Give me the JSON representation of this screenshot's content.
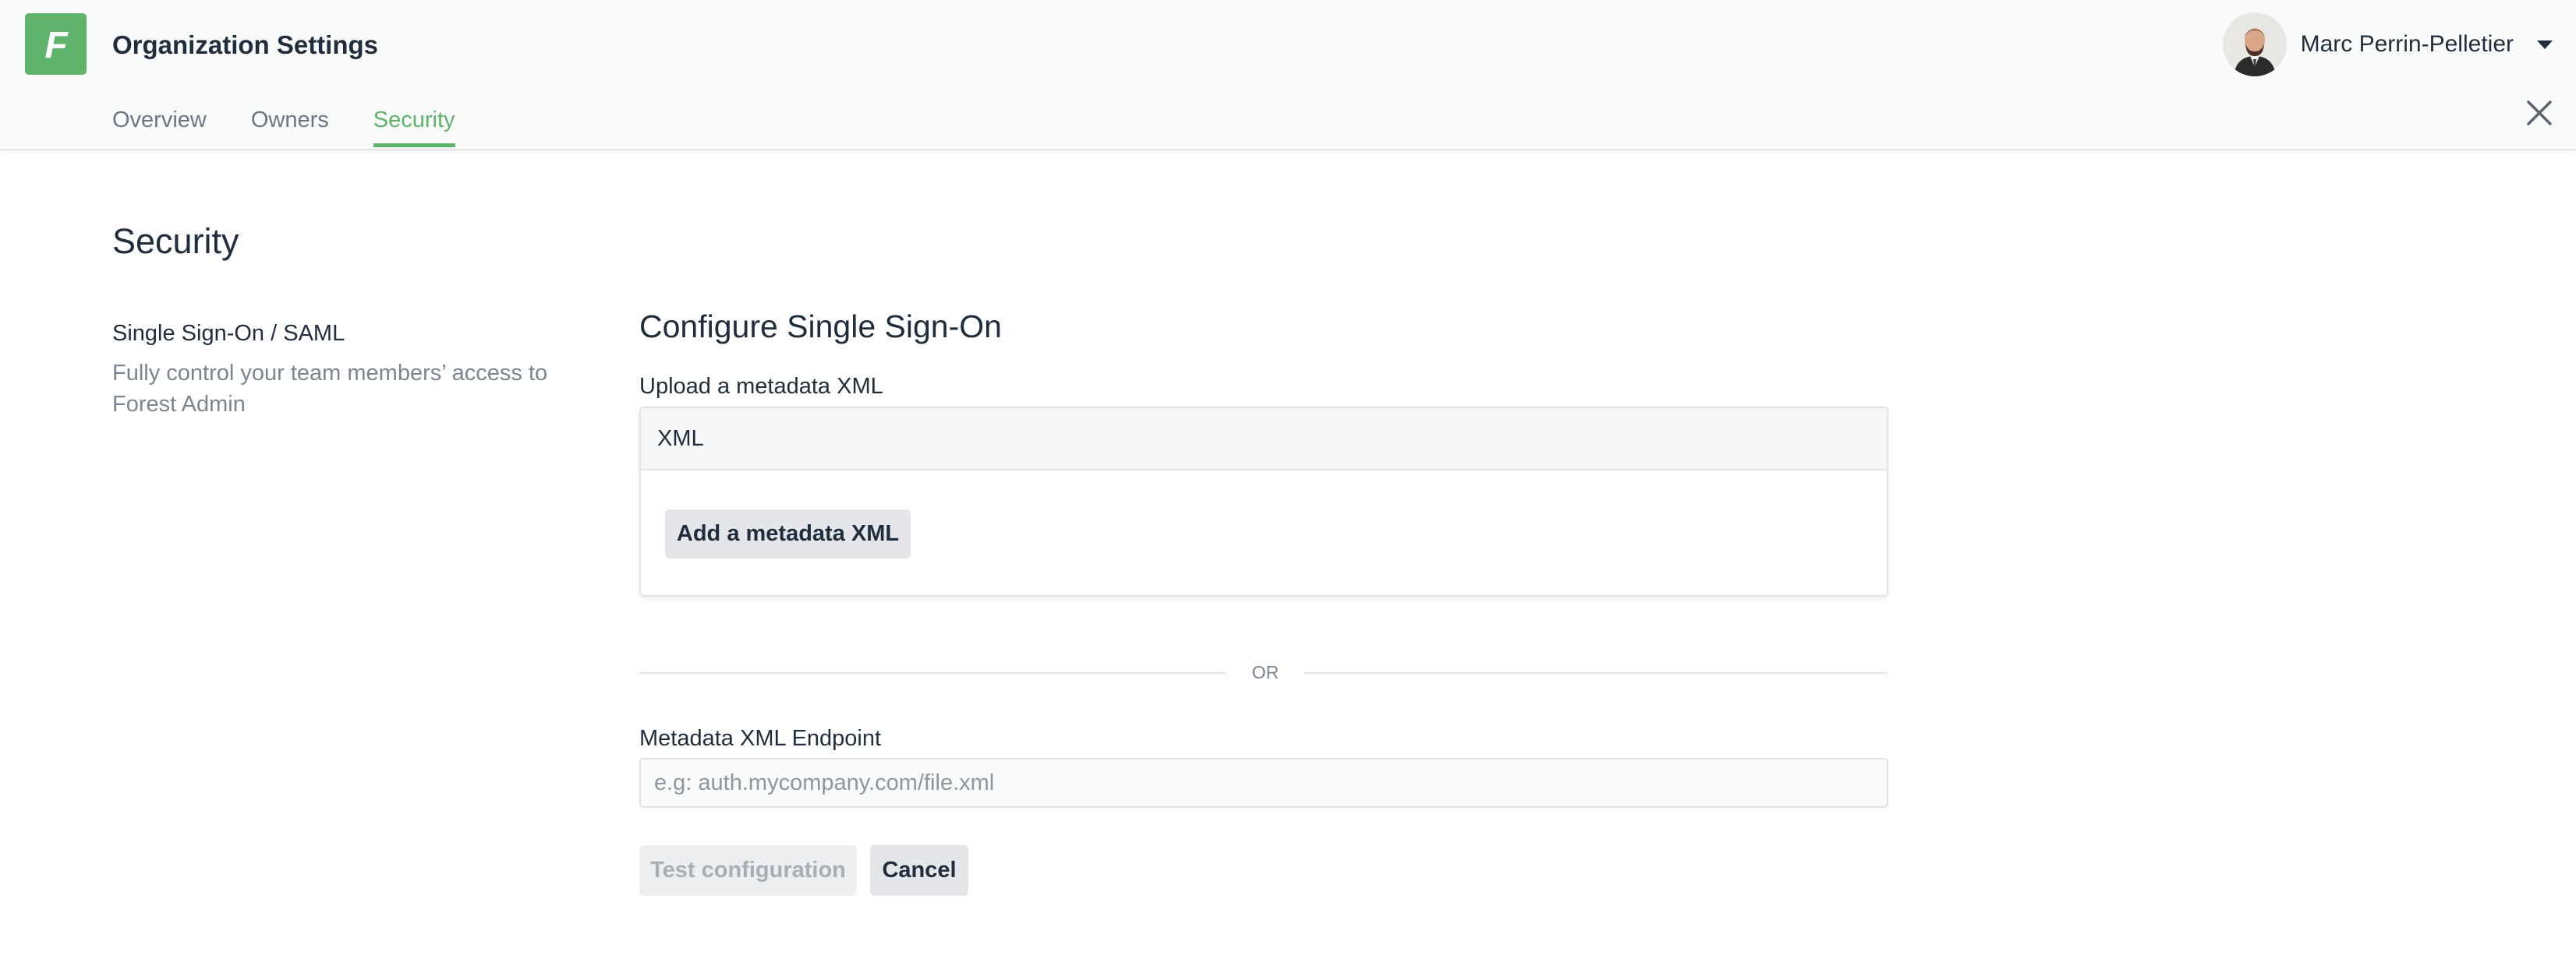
{
  "header": {
    "logo_letter": "F",
    "title": "Organization Settings",
    "tabs": [
      {
        "label": "Overview",
        "active": false
      },
      {
        "label": "Owners",
        "active": false
      },
      {
        "label": "Security",
        "active": true
      }
    ],
    "user": {
      "name": "Marc Perrin-Pelletier"
    }
  },
  "page": {
    "title": "Security"
  },
  "sidebar_section": {
    "title": "Single Sign-On / SAML",
    "description": "Fully control your team members’ access to Forest Admin"
  },
  "form": {
    "title": "Configure Single Sign-On",
    "upload_label": "Upload a metadata XML",
    "upload_box_header": "XML",
    "add_button": "Add a metadata XML",
    "separator": "OR",
    "endpoint_label": "Metadata XML Endpoint",
    "endpoint_value": "",
    "endpoint_placeholder": "e.g: auth.mycompany.com/file.xml",
    "test_button": "Test configuration",
    "test_button_disabled": true,
    "cancel_button": "Cancel"
  },
  "colors": {
    "brand": "#5fb36b",
    "text": "#1f2d3d",
    "muted": "#7b8591",
    "header_bg": "#f9fafa"
  },
  "icons": {
    "logo": "forest-admin-logo-icon",
    "dropdown": "chevron-down-icon",
    "close": "close-icon"
  }
}
